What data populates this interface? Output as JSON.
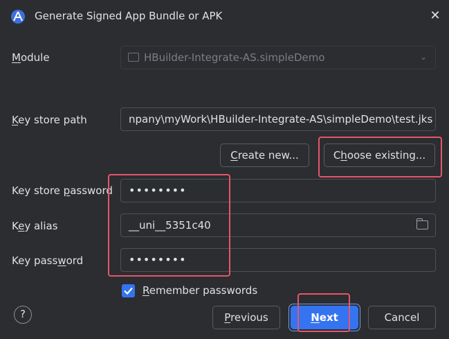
{
  "dialog": {
    "title": "Generate Signed App Bundle or APK"
  },
  "form": {
    "module": {
      "label_prefix": "",
      "label_mnemonic": "M",
      "label_rest": "odule",
      "value": "HBuilder-Integrate-AS.simpleDemo"
    },
    "key_store_path": {
      "label_mnemonic": "K",
      "label_rest": "ey store path",
      "value": "npany\\myWork\\HBuilder-Integrate-AS\\simpleDemo\\test.jks"
    },
    "create_new_label_pre": "",
    "create_new_mnemonic": "C",
    "create_new_rest": "reate new...",
    "choose_existing_pre": "C",
    "choose_existing_mnemonic": "h",
    "choose_existing_rest": "oose existing...",
    "key_store_password": {
      "label_pre": "Key store ",
      "label_mnemonic": "p",
      "label_rest": "assword",
      "value": "••••••••"
    },
    "key_alias": {
      "label_pre": "K",
      "label_mnemonic": "e",
      "label_rest": "y alias",
      "value": "__uni__5351c40"
    },
    "key_password": {
      "label_pre": "Key pass",
      "label_mnemonic": "w",
      "label_rest": "ord",
      "value": "••••••••"
    },
    "remember": {
      "checked": true,
      "label_mnemonic": "R",
      "label_rest": "emember passwords"
    }
  },
  "footer": {
    "help": "?",
    "previous_pre": "",
    "previous_mnemonic": "P",
    "previous_rest": "revious",
    "next_pre": "",
    "next_mnemonic": "N",
    "next_rest": "ext",
    "cancel": "Cancel"
  },
  "colors": {
    "background": "#2b2d30",
    "accent": "#3574f0",
    "highlight": "#e5566b"
  },
  "icons": [
    "android-studio-icon",
    "close-icon",
    "module-icon",
    "chevron-down-icon",
    "folder-icon",
    "checkmark-icon",
    "help-icon"
  ]
}
